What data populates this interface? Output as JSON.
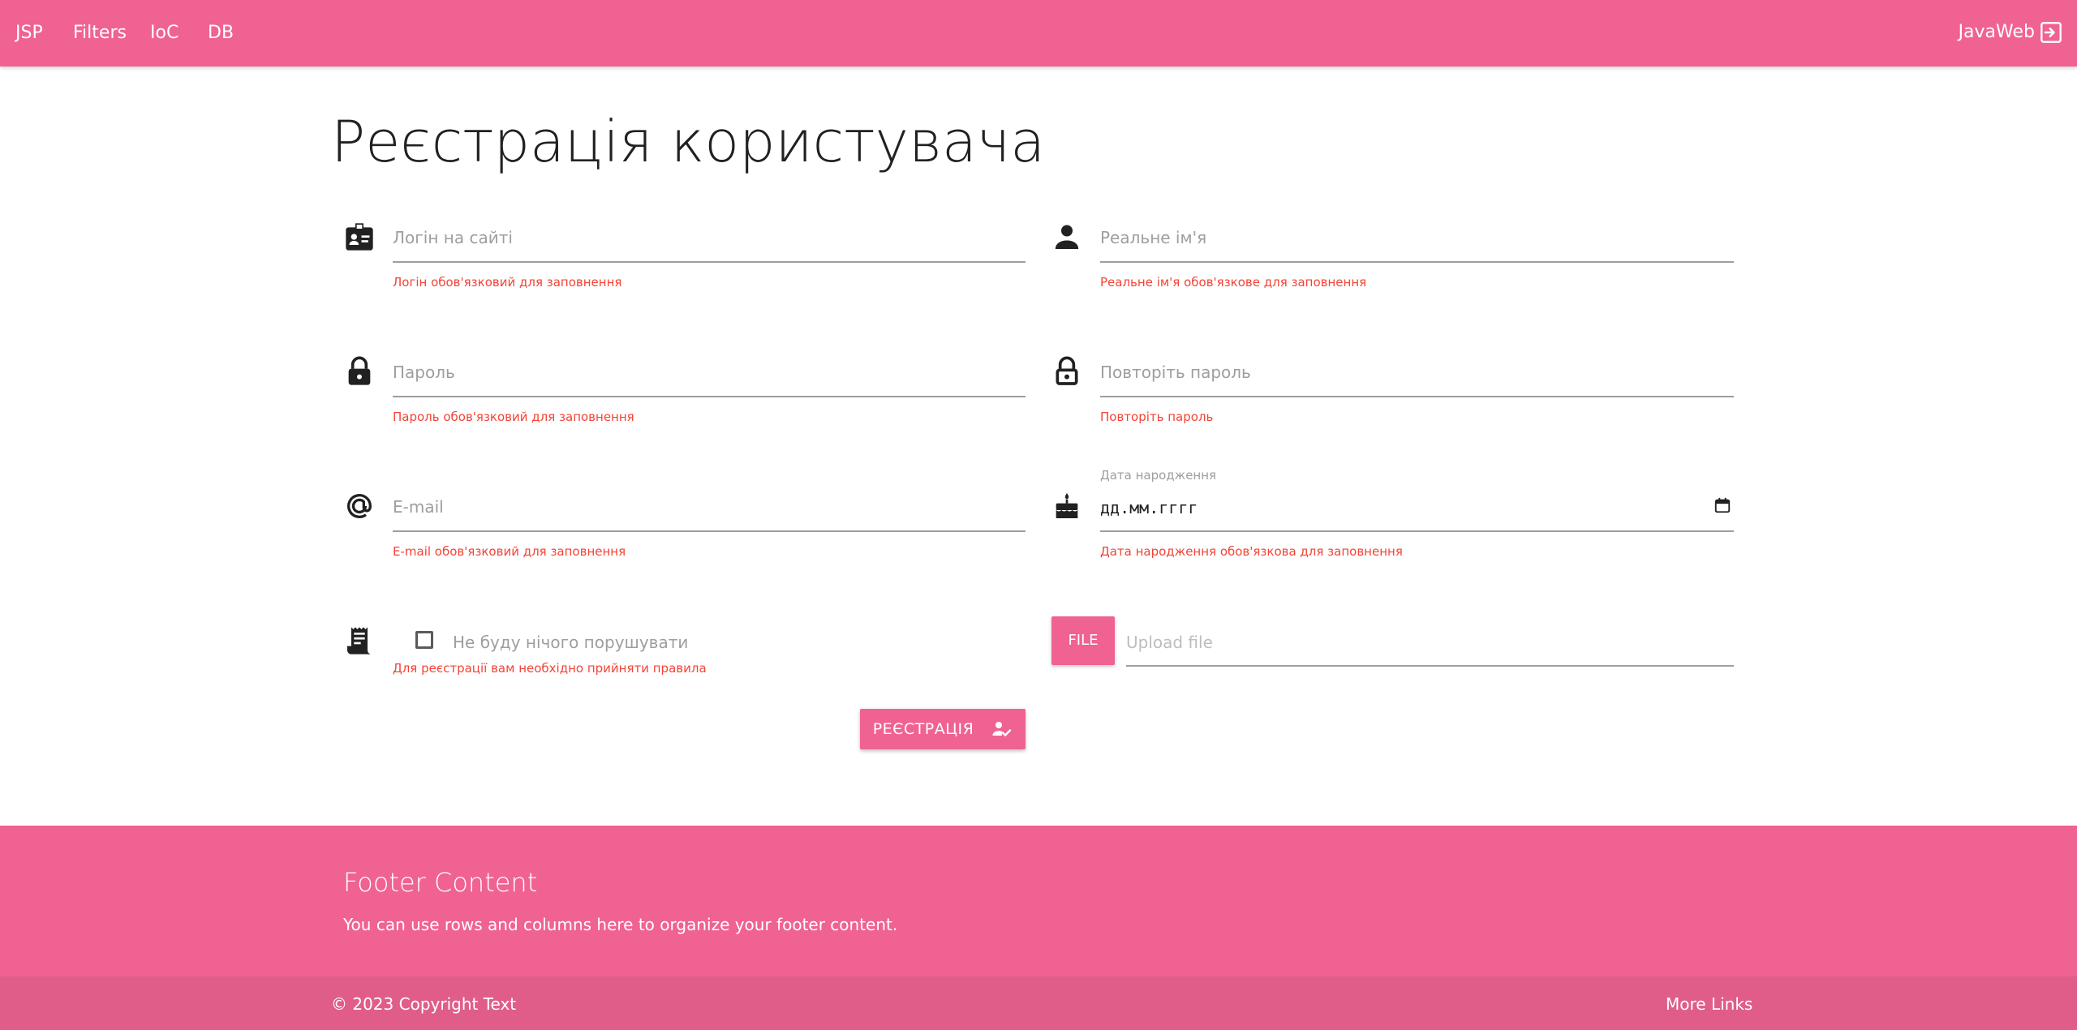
{
  "nav": {
    "links": [
      "JSP",
      "Filters",
      "IoC",
      "DB"
    ],
    "brand": "JavaWeb",
    "brand_icon": "sign-in-icon"
  },
  "colors": {
    "accent": "#f06292",
    "footer_copyright_bg": "#e05d8a",
    "error": "#f44336"
  },
  "page_title": "Реєстрація користувача",
  "form": {
    "login": {
      "icon": "badge-icon",
      "placeholder": "Логін на сайті",
      "error": "Логін обов'язковий для заповнення"
    },
    "real_name": {
      "icon": "person-icon",
      "placeholder": "Реальне ім'я",
      "error": "Реальне ім'я обов'язкове для заповнення"
    },
    "password": {
      "icon": "lock-icon",
      "placeholder": "Пароль",
      "error": "Пароль обов'язковий для заповнення"
    },
    "repeat_password": {
      "icon": "lock-open-icon",
      "placeholder": "Повторіть пароль",
      "error": "Повторіть пароль"
    },
    "email": {
      "icon": "at-icon",
      "placeholder": "E-mail",
      "error": "E-mail обов'язковий для заповнення"
    },
    "birthdate": {
      "icon": "cake-icon",
      "label": "Дата народження",
      "value": "дд.мм.гггг",
      "error": "Дата народження обов'язкова для заповнення",
      "calendar_icon": "calendar-icon"
    },
    "rules": {
      "icon": "receipt-icon",
      "checkbox_label": "Не буду нічого порушувати",
      "checked": false,
      "error": "Для реєстрації вам необхідно прийняти правила"
    },
    "file": {
      "button_label": "FILE",
      "placeholder": "Upload file"
    },
    "submit": {
      "label": "РЕЄСТРАЦІЯ",
      "icon": "person-check-icon"
    }
  },
  "footer": {
    "title": "Footer Content",
    "text": "You can use rows and columns here to organize your footer content.",
    "copyright": "© 2023 Copyright Text",
    "more_links": "More Links"
  }
}
